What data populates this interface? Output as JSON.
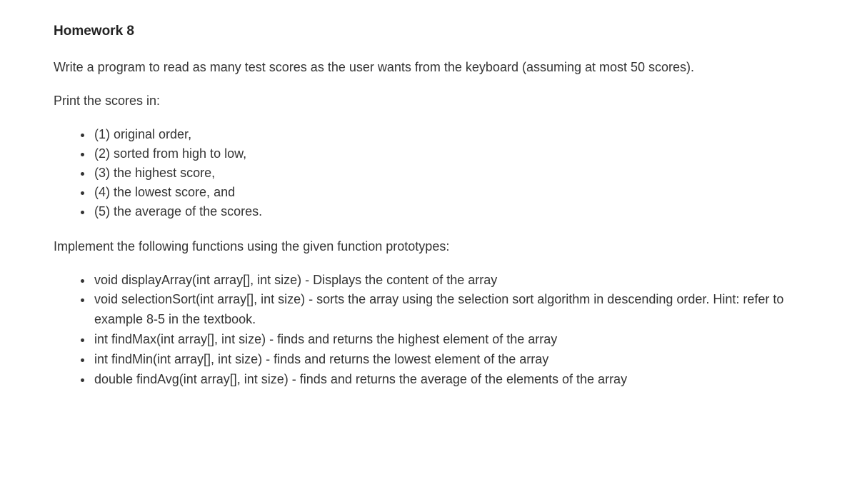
{
  "title": "Homework 8",
  "intro": "Write a program to read as many test scores as the user wants from the keyboard (assuming at most 50 scores).",
  "print_lead": "Print the scores in:",
  "print_items": [
    "(1) original order,",
    "(2) sorted from high to low,",
    "(3) the highest score,",
    "(4) the lowest score, and",
    "(5) the average of the scores."
  ],
  "impl_lead": "Implement the following functions using the given function prototypes:",
  "func_items": [
    "void displayArray(int array[], int size) -  Displays the content of the array",
    "void selectionSort(int array[], int size) - sorts the array using the selection sort algorithm in descending order.  Hint: refer to example 8-5 in the textbook.",
    "int findMax(int array[], int size) -  finds and returns the highest element of the array",
    "int findMin(int array[], int size) -  finds and returns the lowest element of the array",
    "double findAvg(int array[], int size) - finds and returns the average of the elements of the array"
  ]
}
